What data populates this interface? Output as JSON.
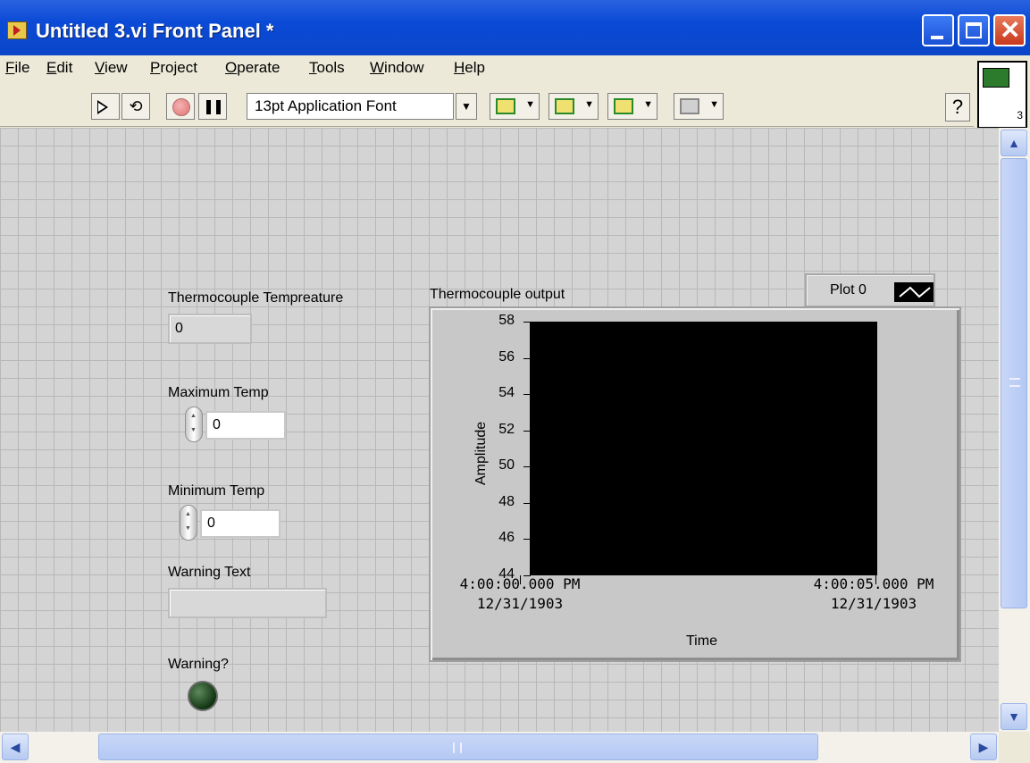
{
  "window": {
    "title": "Untitled 3.vi Front Panel *",
    "close_glyph": "✕"
  },
  "menu": [
    "File",
    "Edit",
    "View",
    "Project",
    "Operate",
    "Tools",
    "Window",
    "Help"
  ],
  "toolbar": {
    "font_select": "13pt Application Font",
    "dropdown_glyph": "▼",
    "run_icon": "run-arrow-icon",
    "run_continuously_icon": "run-continuously-icon",
    "abort_icon": "abort-icon",
    "pause_icon": "pause-icon",
    "help_glyph": "?"
  },
  "controls": {
    "thermocouple_temp": {
      "label": "Thermocouple Tempreature",
      "value": "0"
    },
    "max_temp": {
      "label": "Maximum Temp",
      "value": "0"
    },
    "min_temp": {
      "label": "Minimum Temp",
      "value": "0"
    },
    "warning_text": {
      "label": "Warning Text",
      "value": ""
    },
    "warning_led": {
      "label": "Warning?",
      "on": false
    }
  },
  "chart_data": {
    "type": "line",
    "title": "Thermocouple output",
    "xlabel": "Time",
    "ylabel": "Amplitude",
    "ylim": [
      44,
      58
    ],
    "yticks": [
      "58",
      "56",
      "54",
      "52",
      "50",
      "48",
      "46",
      "44"
    ],
    "xticks": [
      {
        "time": "4:00:00.000 PM",
        "date": "12/31/1903"
      },
      {
        "time": "4:00:05.000 PM",
        "date": "12/31/1903"
      }
    ],
    "series": [
      {
        "name": "Plot 0",
        "values": []
      }
    ],
    "plot_background": "#000000"
  },
  "scrollbars": {
    "up": "▲",
    "down": "▼",
    "left": "◀",
    "right": "▶"
  }
}
